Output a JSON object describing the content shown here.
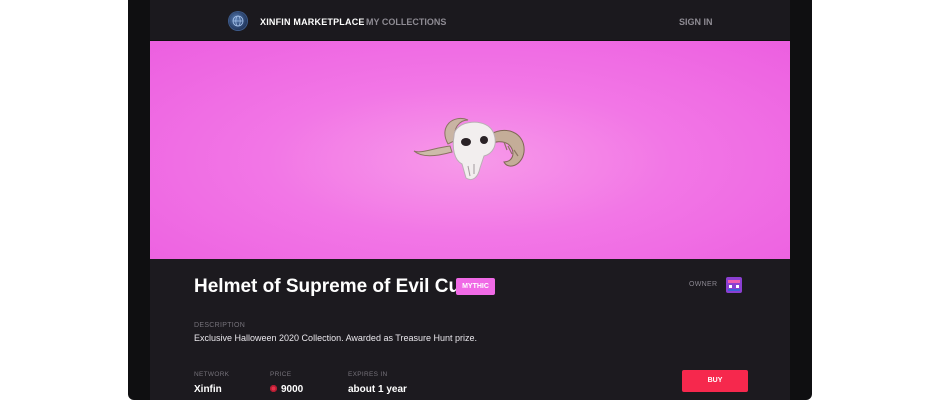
{
  "header": {
    "brand": "XINFIN MARKETPLACE",
    "nav_collections": "MY COLLECTIONS",
    "nav_signin": "SIGN IN",
    "logo_icon": "globe-icon"
  },
  "hero": {
    "background_color": "#f276e6",
    "image_subject": "ram-skull-helmet"
  },
  "item": {
    "title": "Helmet of Supreme of Evil Cult",
    "rarity_badge": "MYTHIC",
    "rarity_color": "#f06ae6",
    "owner_label": "OWNER",
    "owner_avatar_icon": "pixel-avatar-icon",
    "description_label": "DESCRIPTION",
    "description": "Exclusive Halloween 2020 Collection. Awarded as Treasure Hunt prize.",
    "network_label": "NETWORK",
    "network_value": "Xinfin",
    "price_label": "PRICE",
    "price_value": "9000",
    "price_icon": "token-icon",
    "expires_label": "EXPIRES IN",
    "expires_value": "about 1 year",
    "buy_label": "BUY",
    "buy_color": "#f6284d"
  }
}
